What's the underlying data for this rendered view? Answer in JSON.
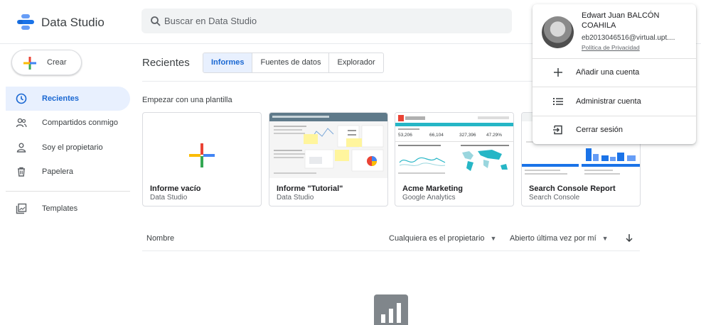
{
  "app": {
    "name": "Data Studio"
  },
  "search": {
    "placeholder": "Buscar en Data Studio"
  },
  "sidebar": {
    "create_label": "Crear",
    "items": [
      {
        "label": "Recientes",
        "icon": "clock-icon",
        "active": true
      },
      {
        "label": "Compartidos conmigo",
        "icon": "people-icon",
        "active": false
      },
      {
        "label": "Soy el propietario",
        "icon": "person-icon",
        "active": false
      },
      {
        "label": "Papelera",
        "icon": "trash-icon",
        "active": false
      },
      {
        "label": "Templates",
        "icon": "templates-icon",
        "active": false
      }
    ]
  },
  "main": {
    "title": "Recientes",
    "tabs": [
      {
        "label": "Informes",
        "active": true
      },
      {
        "label": "Fuentes de datos",
        "active": false
      },
      {
        "label": "Explorador",
        "active": false
      }
    ],
    "template_section_title": "Empezar con una plantilla",
    "templates": [
      {
        "title": "Informe vacío",
        "subtitle": "Data Studio"
      },
      {
        "title": "Informe \"Tutorial\"",
        "subtitle": "Data Studio"
      },
      {
        "title": "Acme Marketing",
        "subtitle": "Google Analytics"
      },
      {
        "title": "Search Console Report",
        "subtitle": "Search Console"
      }
    ],
    "acme_stats": [
      "53,206",
      "66,104",
      "327,396",
      "47.29%"
    ],
    "list": {
      "name_column": "Nombre",
      "owner_filter": "Cualquiera es el propietario",
      "sort_filter": "Abierto última vez por mí"
    }
  },
  "account_popup": {
    "name": "Edwart Juan BALCÓN COAHILA",
    "email": "eb2013046516@virtual.upt....",
    "privacy_link": "Política de Privacidad",
    "menu": [
      {
        "label": "Añadir una cuenta",
        "icon": "plus-icon"
      },
      {
        "label": "Administrar cuenta",
        "icon": "list-icon"
      },
      {
        "label": "Cerrar sesión",
        "icon": "logout-icon"
      }
    ]
  },
  "colors": {
    "accent": "#1967d2",
    "active_bg": "#e8f0fe",
    "acme_teal": "#26b6c6",
    "tutorial_header": "#5f7a8a"
  }
}
